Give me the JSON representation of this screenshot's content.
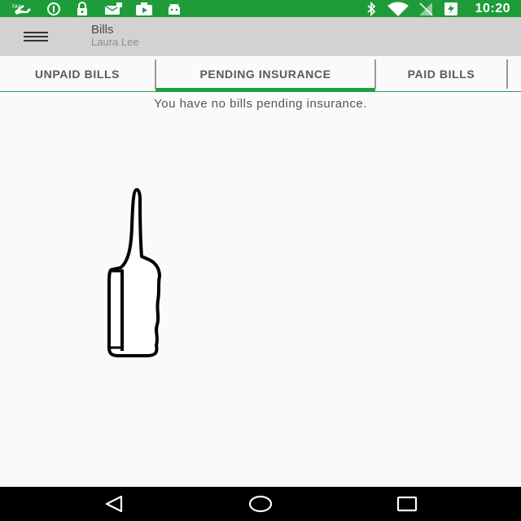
{
  "status_bar": {
    "time": "10:20",
    "left_icons": [
      "fax-plane-icon",
      "circle-info-icon",
      "lock-icon",
      "mail-stack-icon",
      "play-store-icon",
      "android-icon"
    ],
    "right_icons": [
      "bluetooth-icon",
      "wifi-icon",
      "cell-signal-off-icon",
      "battery-charging-icon"
    ],
    "color": "#1e9c3a"
  },
  "app_bar": {
    "title": "Bills",
    "subtitle": "Laura Lee",
    "menu_icon": "hamburger-menu-icon"
  },
  "tabs": [
    {
      "label": "UNPAID BILLS",
      "active": false
    },
    {
      "label": "PENDING INSURANCE",
      "active": true
    },
    {
      "label": "PAID BILLS",
      "active": false
    }
  ],
  "content": {
    "empty_message": "You have no bills pending insurance.",
    "illustration": "pointing-hand-icon"
  },
  "nav_bar": {
    "buttons": [
      "back-icon",
      "home-icon",
      "recents-icon"
    ]
  },
  "accent_color": "#1f9e45"
}
